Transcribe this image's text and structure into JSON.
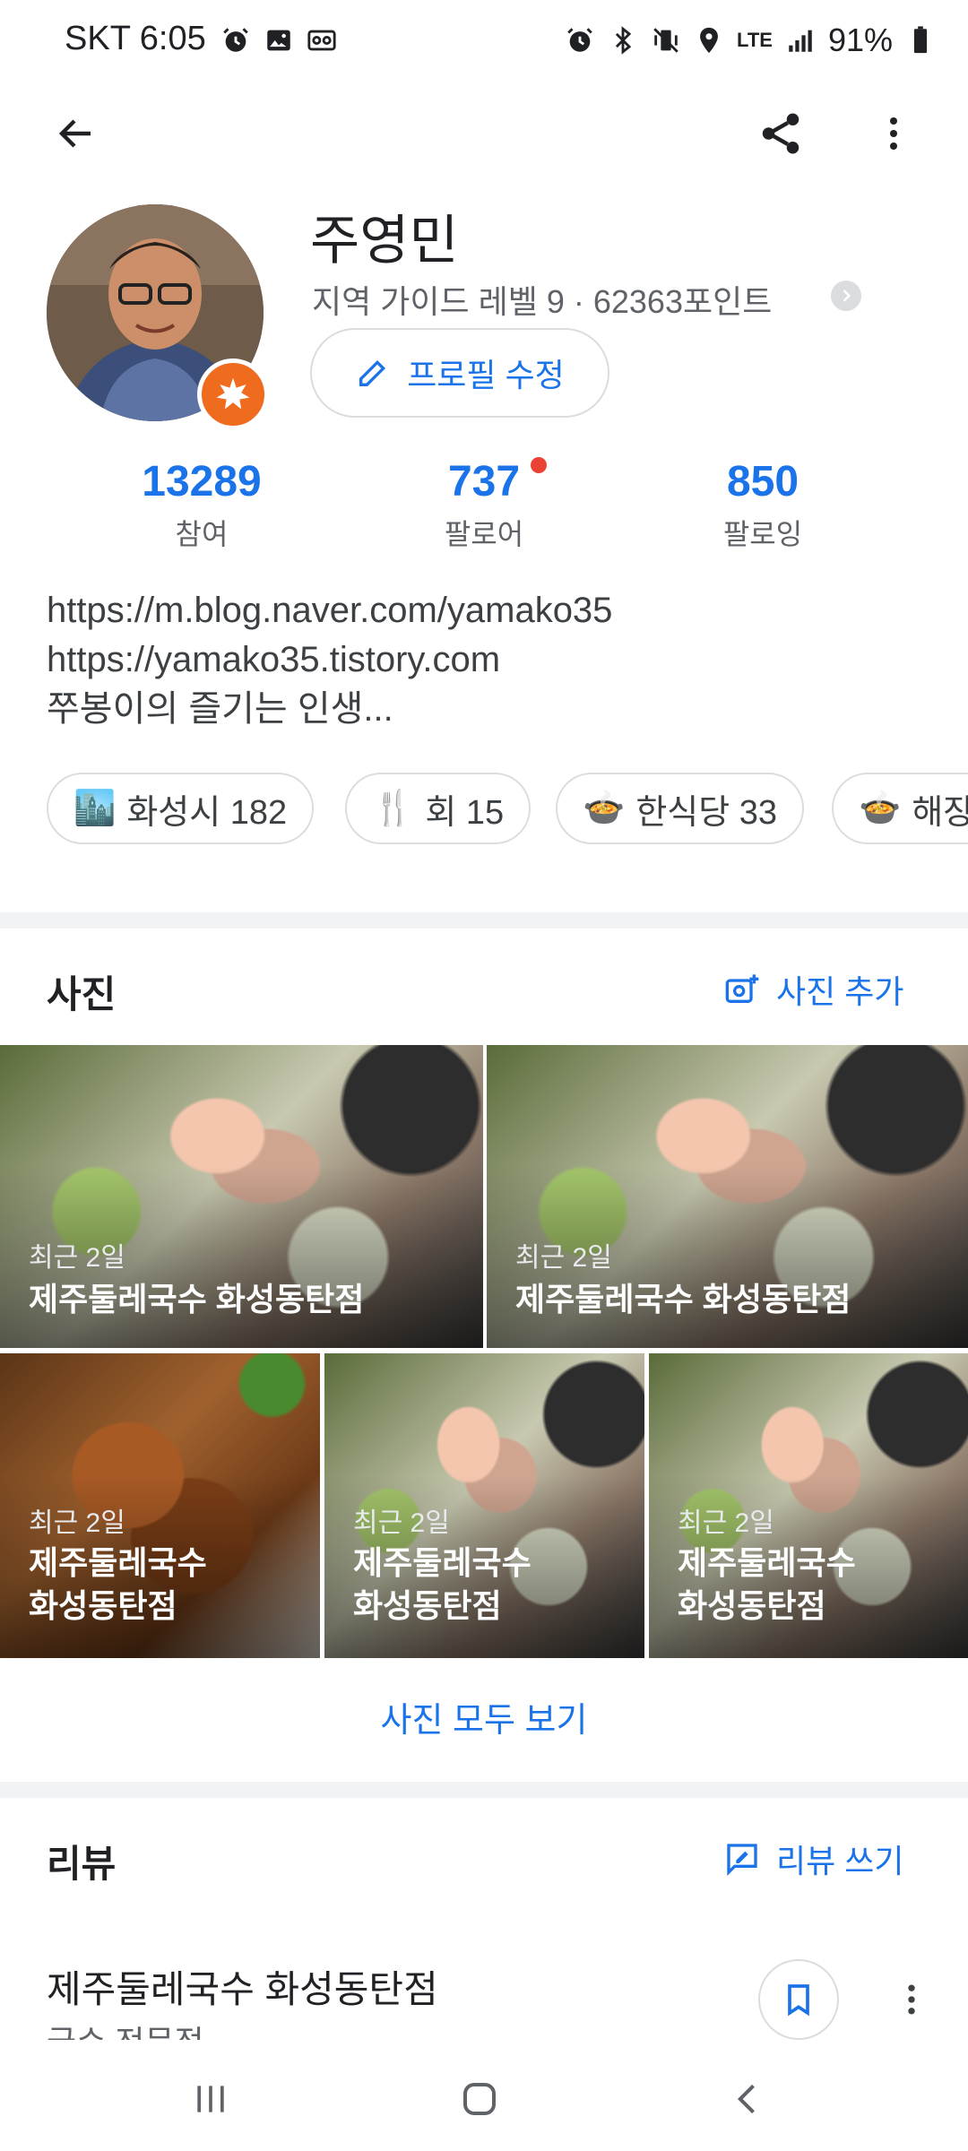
{
  "status_bar": {
    "carrier_time": "SKT 6:05",
    "network": "LTE",
    "battery": "91%",
    "left_icons": [
      "alarm-icon",
      "gallery-icon",
      "voicemail-icon"
    ],
    "right_icons": [
      "alarm-icon",
      "bluetooth-icon",
      "vibrate-icon",
      "location-icon",
      "signal-icon",
      "battery-icon"
    ]
  },
  "app_bar": {
    "back_icon": "back-arrow-icon",
    "share_icon": "share-icon",
    "more_icon": "more-vert-icon"
  },
  "profile": {
    "name": "주영민",
    "guide_info": "지역 가이드 레벨 9 · 62363포인트",
    "edit_label": "프로필 수정",
    "stats": [
      {
        "value": "13289",
        "label": "참여"
      },
      {
        "value": "737",
        "label": "팔로어"
      },
      {
        "value": "850",
        "label": "팔로잉"
      }
    ],
    "bio": [
      "https://m.blog.naver.com/yamako35",
      "https://yamako35.tistory.com",
      "쭈봉이의 즐기는 인생..."
    ],
    "chips": [
      {
        "emoji": "🏙️",
        "label": "화성시 182"
      },
      {
        "emoji": "🍴",
        "label": "회 15"
      },
      {
        "emoji": "🍲",
        "label": "한식당 33"
      },
      {
        "emoji": "🍲",
        "label": "해장"
      }
    ]
  },
  "photos": {
    "title": "사진",
    "add_label": "사진 추가",
    "items": [
      {
        "date": "최근 2일",
        "place": "제주둘레국수 화성동탄점"
      },
      {
        "date": "최근 2일",
        "place": "제주둘레국수 화성동탄점"
      },
      {
        "date": "최근 2일",
        "place_line1": "제주둘레국수",
        "place_line2": "화성동탄점"
      },
      {
        "date": "최근 2일",
        "place_line1": "제주둘레국수",
        "place_line2": "화성동탄점"
      },
      {
        "date": "최근 2일",
        "place_line1": "제주둘레국수",
        "place_line2": "화성동탄점"
      }
    ],
    "show_all": "사진 모두 보기"
  },
  "reviews": {
    "title": "리뷰",
    "write_label": "리뷰 쓰기",
    "first": {
      "place": "제주둘레국수 화성동탄점",
      "category": "국수 전문점"
    }
  },
  "colors": {
    "accent": "#1a73e8",
    "badge": "#ef6c1f",
    "dot": "#ea4335",
    "divider": "#f1f3f4"
  }
}
